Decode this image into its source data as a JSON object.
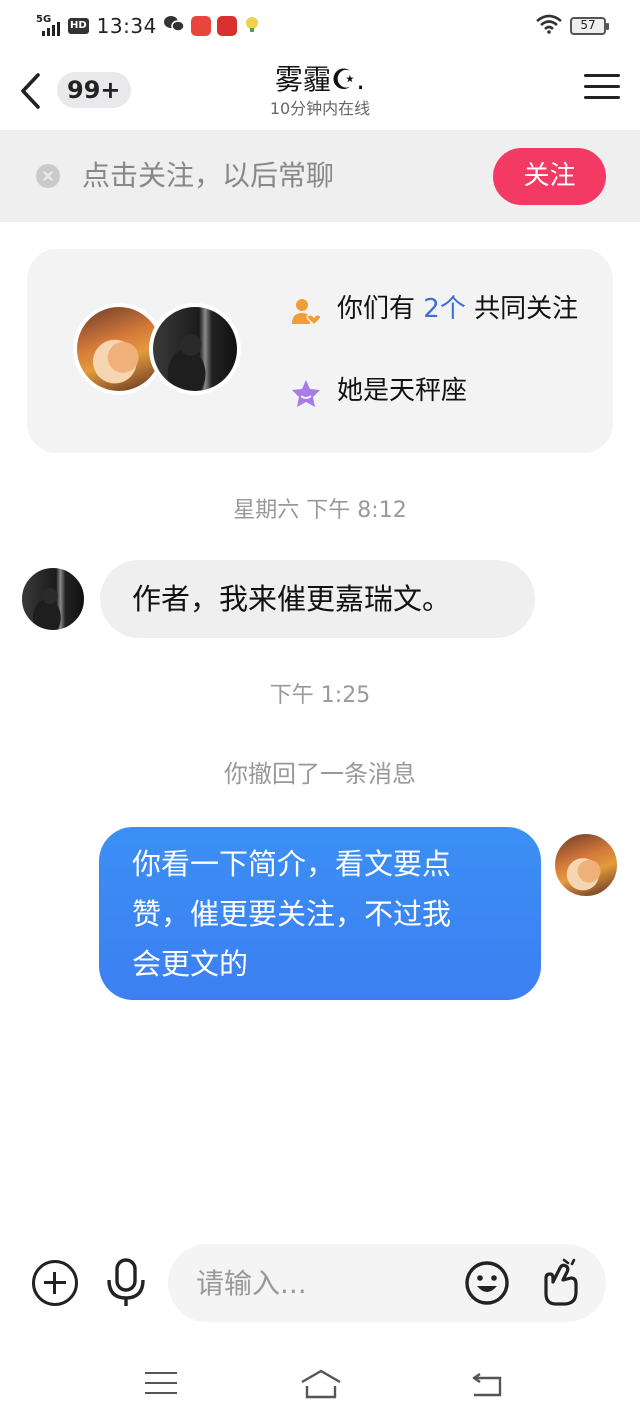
{
  "status_bar": {
    "network": "5G",
    "hd": "HD",
    "time": "13:34",
    "battery": "57"
  },
  "header": {
    "unread_count": "99+",
    "peer_name": "雾霾☪.",
    "peer_status": "10分钟内在线"
  },
  "follow_bar": {
    "prompt": "点击关注，以后常聊",
    "follow_label": "关注"
  },
  "info_card": {
    "mutual_prefix": "你们有",
    "mutual_count": "2个",
    "mutual_suffix": "共同关注",
    "zodiac": "她是天秤座"
  },
  "messages": [
    {
      "type": "timestamp",
      "text": "星期六 下午 8:12"
    },
    {
      "type": "incoming",
      "text": "作者，我来催更嘉瑞文。"
    },
    {
      "type": "timestamp",
      "text": "下午 1:25"
    },
    {
      "type": "system",
      "text": "你撤回了一条消息"
    },
    {
      "type": "outgoing",
      "lines": [
        "你看一下简介，看文要点",
        "赞，催更要关注，不过我",
        "会更文的"
      ]
    }
  ],
  "input": {
    "placeholder": "请输入..."
  },
  "colors": {
    "follow_button": "#f33a64",
    "outgoing_bubble": "#3d84f3",
    "incoming_bubble": "#efefef",
    "mutual_count": "#3b6fd6",
    "person_icon": "#f29c38",
    "star_icon": "#a67ce8"
  },
  "icons": {
    "back": "chevron-left-icon",
    "menu": "hamburger-menu-icon",
    "close": "close-circle-icon",
    "mutual": "person-heart-icon",
    "zodiac": "star-icon",
    "plus": "plus-circle-icon",
    "mic": "microphone-icon",
    "emoji": "smiley-icon",
    "gesture": "finger-heart-icon"
  }
}
